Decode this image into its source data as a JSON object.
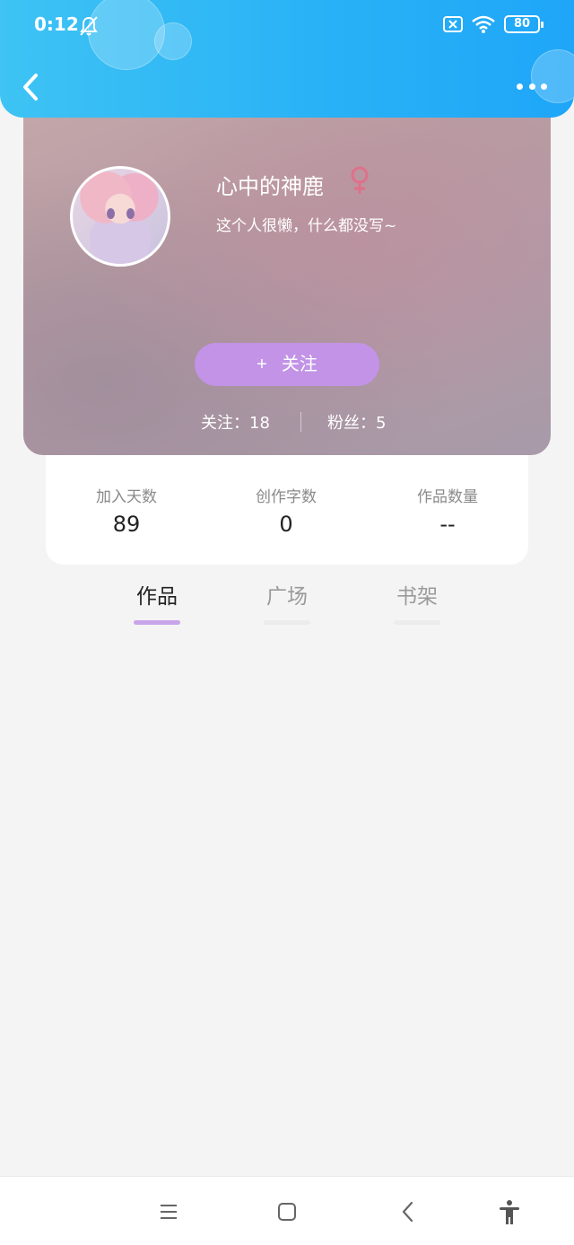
{
  "status_bar": {
    "time": "0:12",
    "battery": "80",
    "icons": [
      "bell-off-icon",
      "sim-x-icon",
      "wifi-icon",
      "battery-icon"
    ]
  },
  "header": {
    "back_icon": "chevron-left-icon",
    "more_icon": "more-dots-icon"
  },
  "profile": {
    "username": "心中的神鹿",
    "gender_symbol": "♀",
    "bio": "这个人很懒，什么都没写~",
    "follow_plus": "+",
    "follow_label": "关注",
    "following_text": "关注：18",
    "fans_text": "粉丝：5"
  },
  "stats": [
    {
      "label": "加入天数",
      "value": "89"
    },
    {
      "label": "创作字数",
      "value": "0"
    },
    {
      "label": "作品数量",
      "value": "--"
    }
  ],
  "tabs": [
    {
      "label": "作品",
      "active": true
    },
    {
      "label": "广场",
      "active": false
    },
    {
      "label": "书架",
      "active": false
    }
  ],
  "nav": [
    "menu-icon",
    "home-icon",
    "back-icon",
    "accessibility-icon"
  ],
  "colors": {
    "header": "#29b2f6",
    "follow_button": "#c293e6",
    "tab_indicator": "#c8a4ea",
    "gender": "#e0708a"
  }
}
